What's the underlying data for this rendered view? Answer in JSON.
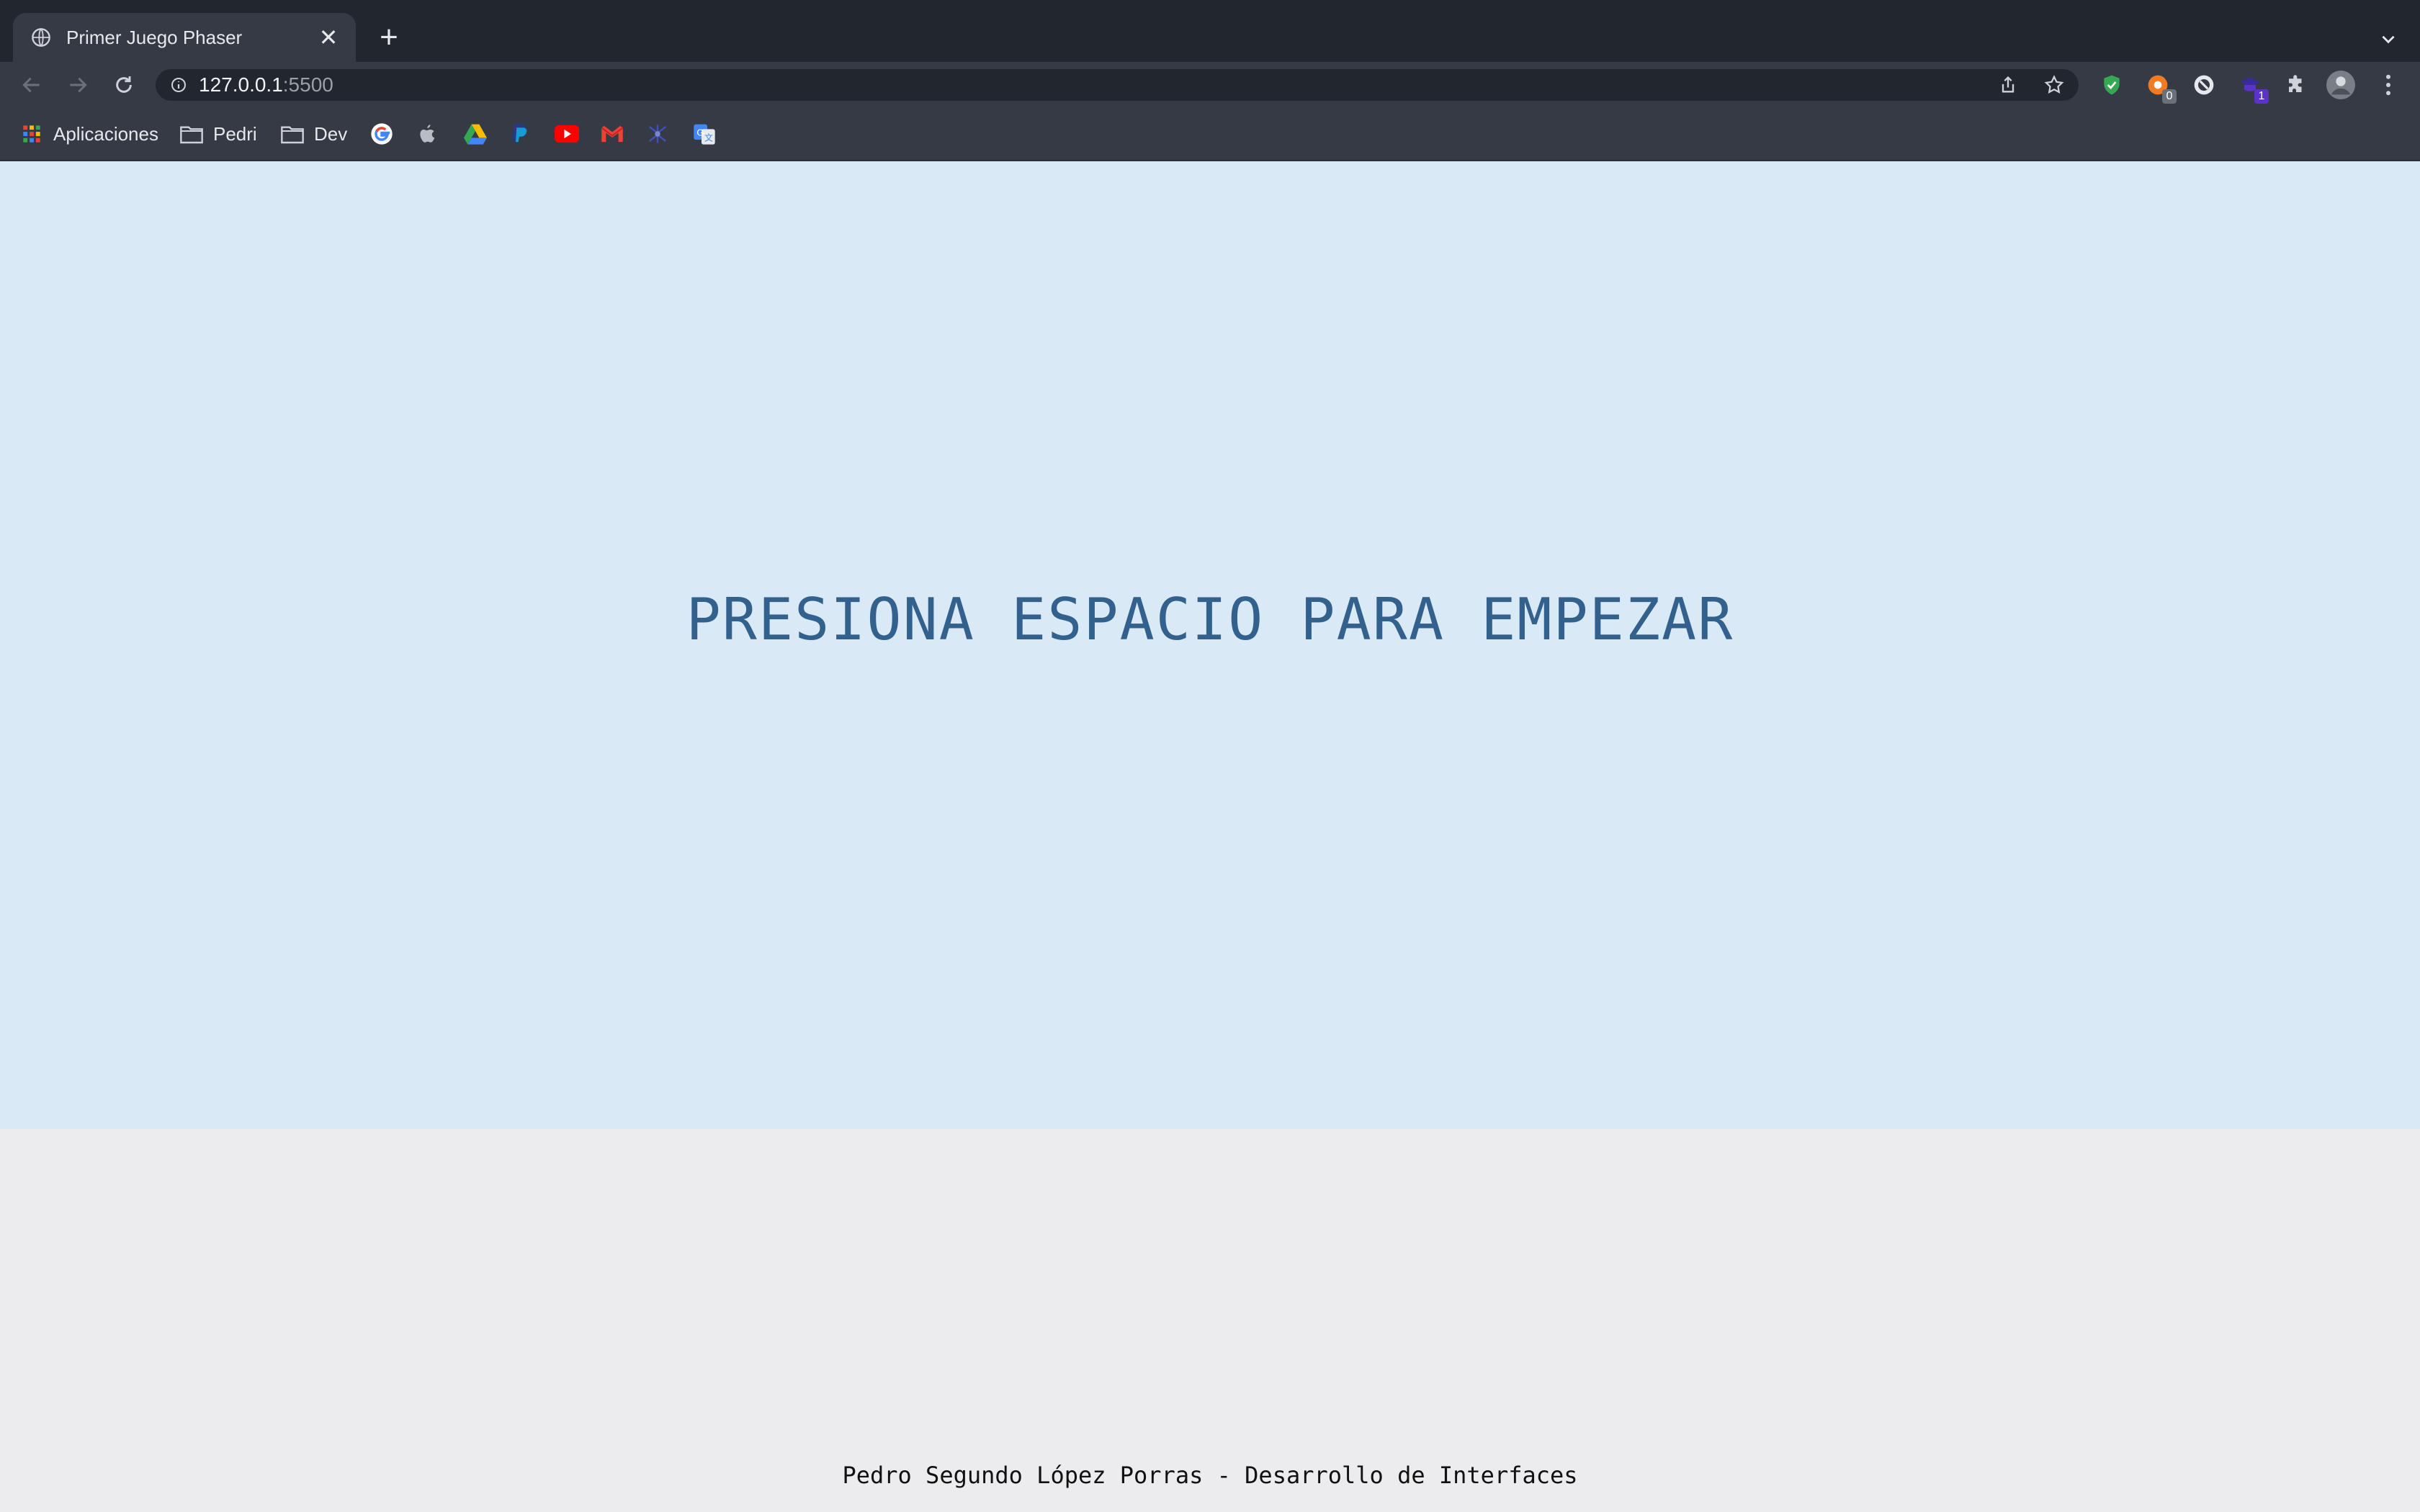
{
  "browser": {
    "tab_title": "Primer Juego Phaser",
    "url_host": "127.0.0.1",
    "url_port": ":5500",
    "new_tab_label": "+",
    "close_label": "✕"
  },
  "extensions": [
    {
      "name": "shield-extension-icon",
      "color": "#34a853",
      "badge": ""
    },
    {
      "name": "extension-orange-icon",
      "color": "#f07b22",
      "badge": "0"
    },
    {
      "name": "extension-block-icon",
      "color": "#e6e8ec",
      "badge": ""
    },
    {
      "name": "extension-purple-icon",
      "color": "#5b33c9",
      "badge": "1"
    }
  ],
  "bookmarks": {
    "apps_label": "Aplicaciones",
    "folders": [
      "Pedri",
      "Dev"
    ],
    "icons": [
      "google-icon",
      "apple-icon",
      "drive-icon",
      "paypal-icon",
      "youtube-icon",
      "gmail-icon",
      "bookmark-logo-icon",
      "translate-icon"
    ]
  },
  "game": {
    "message": "PRESIONA ESPACIO PARA EMPEZAR",
    "background": "#dae9f6",
    "text_color": "#33618e"
  },
  "footer": {
    "credit": "Pedro Segundo López Porras - Desarrollo de Interfaces"
  }
}
